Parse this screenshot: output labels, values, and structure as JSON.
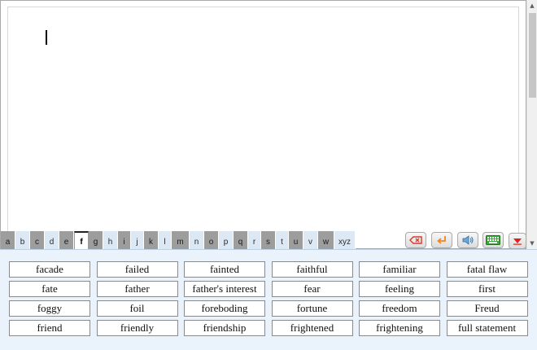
{
  "tabs": [
    {
      "label": "a",
      "shade": "dark",
      "w": 18
    },
    {
      "label": "b",
      "shade": "light",
      "w": 18
    },
    {
      "label": "c",
      "shade": "dark",
      "w": 18
    },
    {
      "label": "d",
      "shade": "light",
      "w": 18
    },
    {
      "label": "e",
      "shade": "dark",
      "w": 18
    },
    {
      "label": "f",
      "shade": "active",
      "w": 18
    },
    {
      "label": "g",
      "shade": "dark",
      "w": 18
    },
    {
      "label": "h",
      "shade": "light",
      "w": 18
    },
    {
      "label": "i",
      "shade": "dark",
      "w": 16
    },
    {
      "label": "j",
      "shade": "light",
      "w": 16
    },
    {
      "label": "k",
      "shade": "dark",
      "w": 18
    },
    {
      "label": "l",
      "shade": "light",
      "w": 16
    },
    {
      "label": "m",
      "shade": "dark",
      "w": 22
    },
    {
      "label": "n",
      "shade": "light",
      "w": 18
    },
    {
      "label": "o",
      "shade": "dark",
      "w": 18
    },
    {
      "label": "p",
      "shade": "light",
      "w": 18
    },
    {
      "label": "q",
      "shade": "dark",
      "w": 18
    },
    {
      "label": "r",
      "shade": "light",
      "w": 16
    },
    {
      "label": "s",
      "shade": "dark",
      "w": 18
    },
    {
      "label": "t",
      "shade": "light",
      "w": 16
    },
    {
      "label": "u",
      "shade": "dark",
      "w": 18
    },
    {
      "label": "v",
      "shade": "light",
      "w": 18
    },
    {
      "label": "w",
      "shade": "dark",
      "w": 20
    },
    {
      "label": "xyz",
      "shade": "light",
      "w": 26
    }
  ],
  "actions": {
    "backspace_icon": "backspace-icon",
    "enter_icon": "enter-icon",
    "speak_icon": "speaker-icon",
    "keyboard_icon": "keyboard-icon",
    "collapse_icon": "collapse-down-icon"
  },
  "colors": {
    "active_tab": "#ffffff",
    "dark_tab": "#9d9d9d",
    "light_tab": "#dce9f5",
    "panel_bg": "#eaf3fb",
    "backspace_red": "#d9392b",
    "enter_orange": "#f0851e",
    "keyboard_green": "#3da93a",
    "collapse_red": "#e02020"
  },
  "words": [
    "facade",
    "failed",
    "fainted",
    "faithful",
    "familiar",
    "fatal flaw",
    "fate",
    "father",
    "father's interest",
    "fear",
    "feeling",
    "first",
    "foggy",
    "foil",
    "foreboding",
    "fortune",
    "freedom",
    "Freud",
    "friend",
    "friendly",
    "friendship",
    "frightened",
    "frightening",
    "full statement"
  ]
}
